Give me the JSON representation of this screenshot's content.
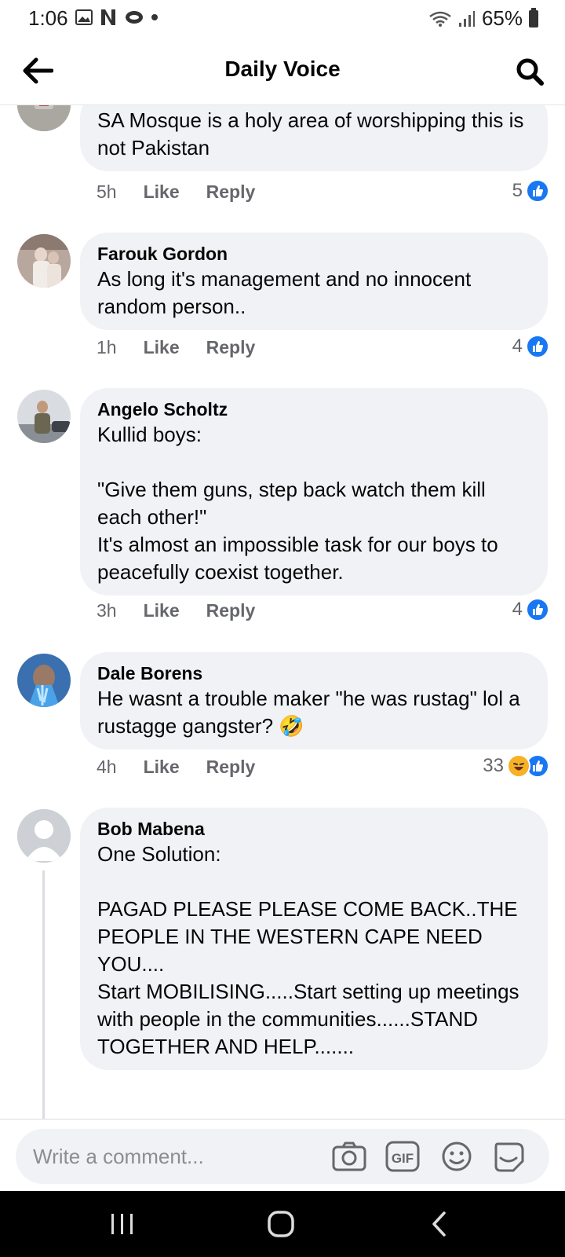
{
  "status_bar": {
    "time": "1:06",
    "battery": "65%"
  },
  "header": {
    "title": "Daily Voice"
  },
  "comments": [
    {
      "author": "",
      "text": "SA Mosque is a holy area of worshipping this is not Pakistan",
      "time": "5h",
      "like_label": "Like",
      "reply_label": "Reply",
      "reaction_count": "5",
      "reactions": [
        "like"
      ]
    },
    {
      "author": "Farouk Gordon",
      "text": "As long it's management and no innocent random person..",
      "time": "1h",
      "like_label": "Like",
      "reply_label": "Reply",
      "reaction_count": "4",
      "reactions": [
        "like"
      ]
    },
    {
      "author": "Angelo Scholtz",
      "text": "Kullid boys:\n\n\"Give them guns, step back watch them kill each other!\"\nIt's almost an impossible task for our boys to peacefully coexist together.",
      "time": "3h",
      "like_label": "Like",
      "reply_label": "Reply",
      "reaction_count": "4",
      "reactions": [
        "like"
      ]
    },
    {
      "author": "Dale Borens",
      "text": "He wasnt a trouble maker \"he was rustag\" lol a rustagge gangster? 🤣",
      "time": "4h",
      "like_label": "Like",
      "reply_label": "Reply",
      "reaction_count": "33",
      "reactions": [
        "haha",
        "like"
      ]
    },
    {
      "author": "Bob Mabena",
      "text": "One Solution:\n\nPAGAD PLEASE PLEASE COME BACK..THE PEOPLE IN THE WESTERN CAPE NEED YOU....\nStart MOBILISING.....Start setting up meetings with people in the communities......STAND TOGETHER AND HELP.......",
      "time": "",
      "like_label": "",
      "reply_label": "",
      "reaction_count": "",
      "reactions": []
    }
  ],
  "composer": {
    "placeholder": "Write a comment...",
    "icons": [
      "camera-icon",
      "gif-icon",
      "emoji-icon",
      "sticker-icon"
    ]
  },
  "nav": {
    "icons": [
      "recent-apps-icon",
      "home-icon",
      "back-icon"
    ]
  },
  "colors": {
    "like_blue": "#1877f2",
    "bubble_bg": "#f0f2f5",
    "meta_grey": "#65676b"
  }
}
